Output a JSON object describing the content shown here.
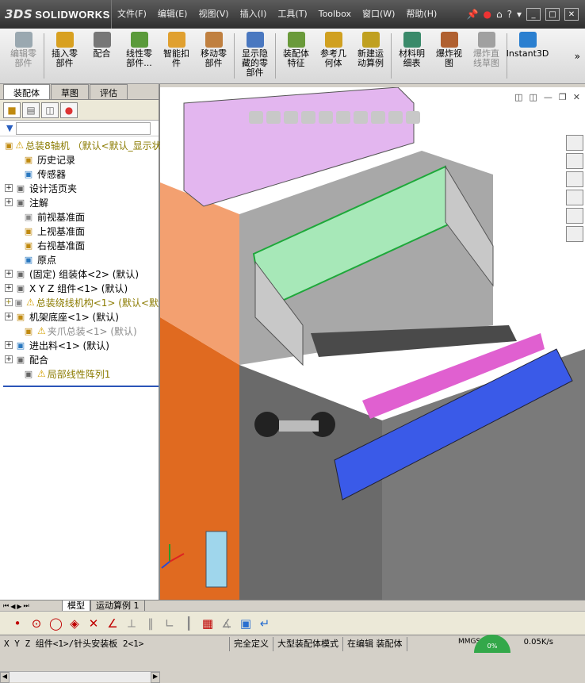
{
  "app": {
    "logo_prefix": "3DS",
    "logo_text": "SOLIDWORKS"
  },
  "menu": [
    "文件(F)",
    "编辑(E)",
    "视图(V)",
    "插入(I)",
    "工具(T)",
    "Toolbox",
    "窗口(W)",
    "帮助(H)"
  ],
  "commands": [
    {
      "label": "编辑零\n部件",
      "enabled": false,
      "color": "#9aa8b0"
    },
    {
      "label": "插入零\n部件",
      "enabled": true,
      "color": "#d8a020"
    },
    {
      "label": "配合",
      "enabled": true,
      "color": "#777777"
    },
    {
      "label": "线性零\n部件...",
      "enabled": true,
      "color": "#5a9a3a"
    },
    {
      "label": "智能扣\n件",
      "enabled": true,
      "color": "#e0a030"
    },
    {
      "label": "移动零\n部件",
      "enabled": true,
      "color": "#c08040"
    },
    {
      "label": "显示隐\n藏的零\n部件",
      "enabled": true,
      "color": "#4a78c0"
    },
    {
      "label": "装配体\n特征",
      "enabled": true,
      "color": "#6a9a3a"
    },
    {
      "label": "参考几\n何体",
      "enabled": true,
      "color": "#d0a020"
    },
    {
      "label": "新建运\n动算例",
      "enabled": true,
      "color": "#c0a020"
    },
    {
      "label": "材料明\n细表",
      "enabled": true,
      "color": "#3a8a6a"
    },
    {
      "label": "爆炸视\n图",
      "enabled": true,
      "color": "#b06030"
    },
    {
      "label": "爆炸直\n线草图",
      "enabled": false,
      "color": "#a0a0a0"
    },
    {
      "label": "Instant3D",
      "enabled": true,
      "color": "#2a7fd0"
    }
  ],
  "command_tabs": [
    "装配体",
    "草图",
    "评估"
  ],
  "active_command_tab": 0,
  "tree": [
    {
      "label": "总装8轴机 （默认<默认_显示状",
      "warn": true,
      "exp": "",
      "style": "root",
      "indent": 0
    },
    {
      "label": "历史记录",
      "warn": false,
      "exp": "",
      "style": "",
      "indent": 1
    },
    {
      "label": "传感器",
      "warn": false,
      "exp": "",
      "style": "",
      "indent": 1
    },
    {
      "label": "设计活页夹",
      "warn": false,
      "exp": "+",
      "style": "",
      "indent": 0
    },
    {
      "label": "注解",
      "warn": false,
      "exp": "+",
      "style": "",
      "indent": 0
    },
    {
      "label": "前视基准面",
      "warn": false,
      "exp": "",
      "style": "",
      "indent": 1
    },
    {
      "label": "上视基准面",
      "warn": false,
      "exp": "",
      "style": "",
      "indent": 1
    },
    {
      "label": "右视基准面",
      "warn": false,
      "exp": "",
      "style": "",
      "indent": 1
    },
    {
      "label": "原点",
      "warn": false,
      "exp": "",
      "style": "",
      "indent": 1
    },
    {
      "label": "(固定) 组装体<2> (默认)",
      "warn": false,
      "exp": "+",
      "style": "",
      "indent": 0
    },
    {
      "label": "X Y Z 组件<1> (默认)",
      "warn": false,
      "exp": "+",
      "style": "",
      "indent": 0
    },
    {
      "label": "总装绕线机构<1> (默认<默",
      "warn": true,
      "exp": "+",
      "style": "olive",
      "indent": 0
    },
    {
      "label": "机架底座<1> (默认)",
      "warn": false,
      "exp": "+",
      "style": "",
      "indent": 0
    },
    {
      "label": "夹爪总装<1> (默认)",
      "warn": true,
      "exp": "",
      "style": "grey",
      "indent": 1
    },
    {
      "label": "进出料<1> (默认)",
      "warn": false,
      "exp": "+",
      "style": "",
      "indent": 0
    },
    {
      "label": "配合",
      "warn": false,
      "exp": "+",
      "style": "",
      "indent": 0
    },
    {
      "label": "局部线性阵列1",
      "warn": true,
      "exp": "",
      "style": "olive",
      "indent": 1
    }
  ],
  "sheet_tabs": [
    "模型",
    "运动算例 1"
  ],
  "status": {
    "path": "X Y Z 组件<1>/针头安装板 2<1>",
    "definition": "完全定义",
    "mode": "大型装配体模式",
    "editing": "在编辑 装配体",
    "units": "MMGS",
    "speed": "0.05K/s",
    "gauge": "0%"
  }
}
